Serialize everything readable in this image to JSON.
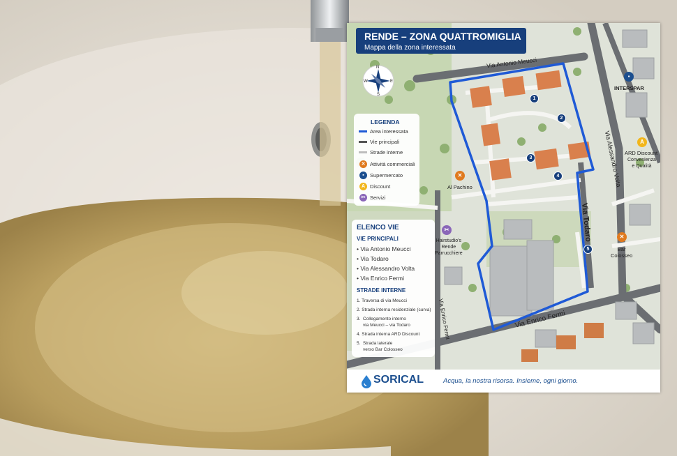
{
  "header": {
    "title": "RENDE – ZONA QUATTROMIGLIA",
    "subtitle": "Mappa della zona interessata"
  },
  "compass": {
    "n": "N",
    "s": "S",
    "e": "E",
    "w": "W"
  },
  "legend": {
    "title": "LEGENDA",
    "items": [
      {
        "label": "Area interessata",
        "kind": "line",
        "color": "#1f5ad6"
      },
      {
        "label": "Vie principali",
        "kind": "line",
        "color": "#555555"
      },
      {
        "label": "Strade interne",
        "kind": "line",
        "color": "#bdbdbd"
      },
      {
        "label": "Attività commerciali",
        "kind": "dot",
        "color": "#e07a1f",
        "icon": "fork-knife-icon",
        "glyph": "✕"
      },
      {
        "label": "Supermercato",
        "kind": "dot",
        "color": "#1c4f8f",
        "icon": "cart-icon",
        "glyph": "▪"
      },
      {
        "label": "Discount",
        "kind": "dot",
        "color": "#f2b61b",
        "icon": "discount-icon",
        "glyph": "A"
      },
      {
        "label": "Servizi",
        "kind": "dot",
        "color": "#8a66b8",
        "icon": "scissors-icon",
        "glyph": "✂"
      }
    ]
  },
  "streets": {
    "title": "ELENCO VIE",
    "main_heading": "VIE PRINCIPALI",
    "main": [
      "• Via Antonio Meucci",
      "• Via Todaro",
      "• Via Alessandro Volta",
      "• Via Enrico Fermi"
    ],
    "internal_heading": "STRADE INTERNE",
    "internal": [
      "1.  Traversa di via Meucci",
      "2.  Strada interna residenziale (curva)",
      "3.  Collegamento interno\n     via Meucci – via Todaro",
      "4.  Strada interna ARD Discount",
      "5.  Strada laterale\n     verso Bar Colosseo"
    ]
  },
  "map_labels": {
    "meucci": "Via Antonio Meucci",
    "todaro": "Via Todaro",
    "volta": "Via Alessandro Volta",
    "fermi_diag": "Via Enrico Fermi",
    "fermi_vert": "Via Enrico Fermi",
    "interspar": "INTERSPAR",
    "ard_name": "ARD Discount",
    "ard_tag": "Convenienza\ne Qualità",
    "pachino": "Al Pachino",
    "hair": "Hairstudio's\nRende\nParrucchiere",
    "bar": "Bar\nColosseo"
  },
  "markers": [
    "1",
    "2",
    "3",
    "4",
    "5"
  ],
  "footer": {
    "brand": "SORICAL",
    "slogan": "Acqua, la nostra risorsa. Insieme, ogni giorno."
  },
  "colors": {
    "navy": "#173f7c",
    "area_outline": "#1f5ad6",
    "water": "#c8ad6e",
    "sink": "#ece7df"
  }
}
